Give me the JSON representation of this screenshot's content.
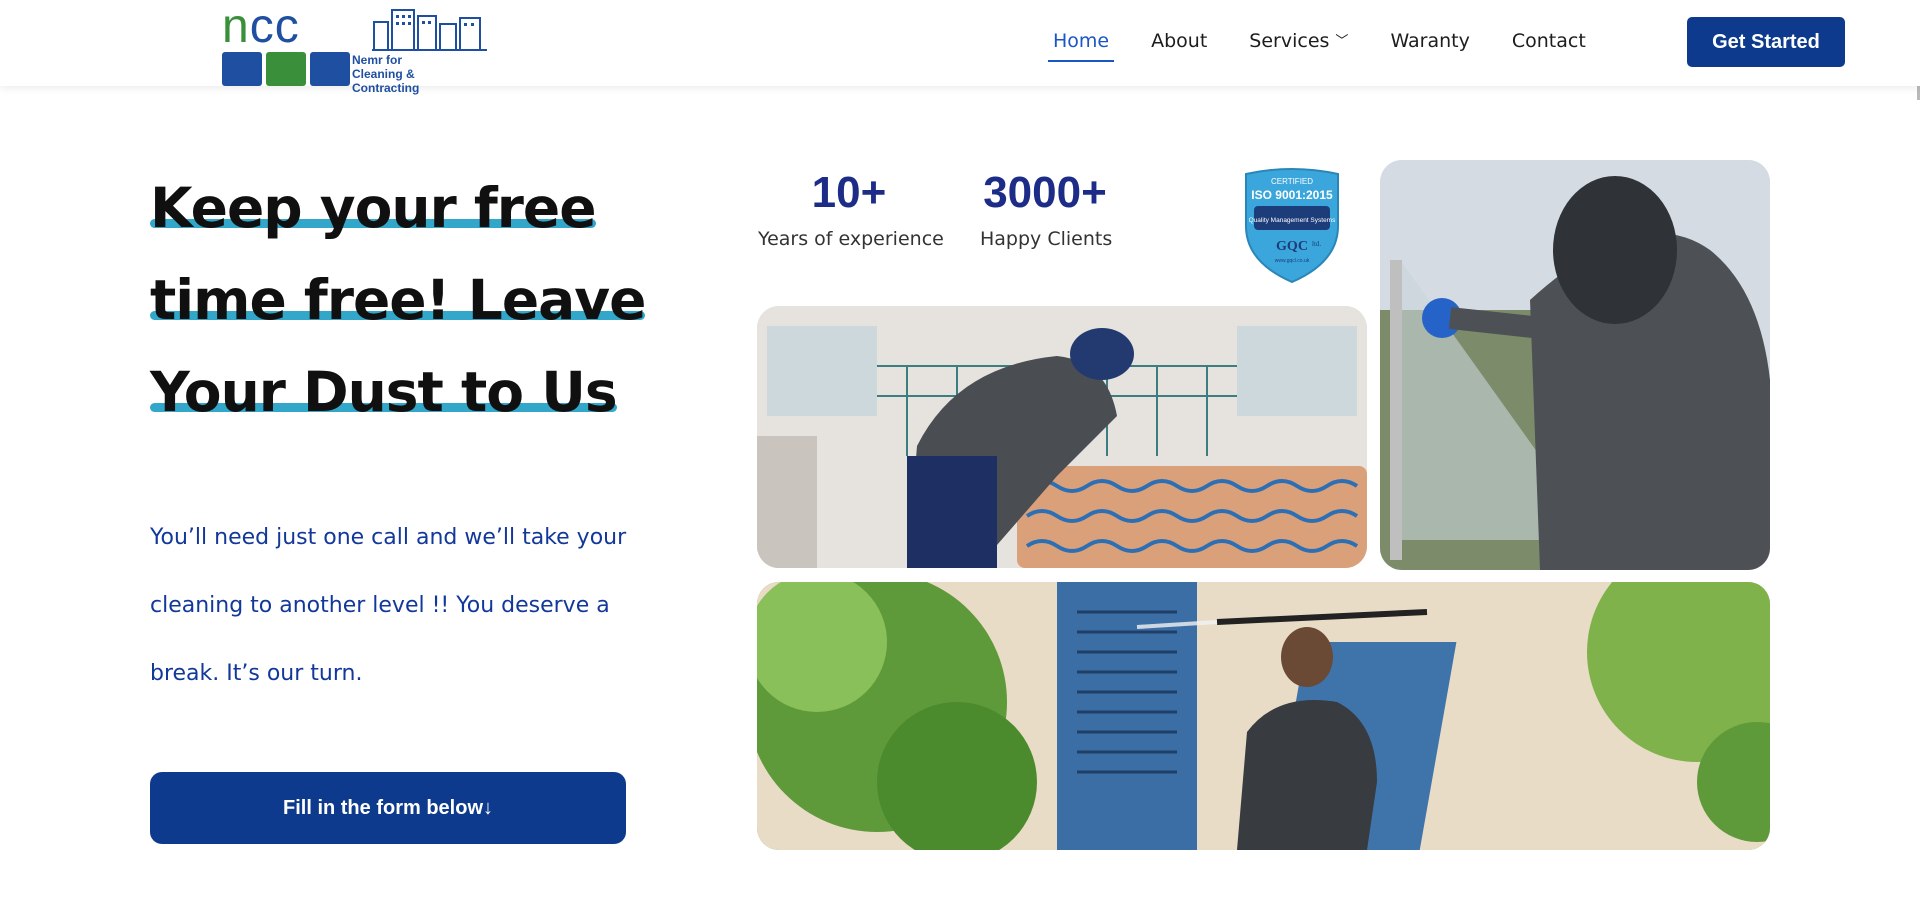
{
  "brand": {
    "logo_letters_n": "n",
    "logo_letters_cc": "cc",
    "tagline": "Nemr for\nCleaning & Contracting",
    "colors": {
      "green": "#3a8f3a",
      "blue": "#1f4fa0"
    }
  },
  "nav": {
    "items": [
      {
        "label": "Home",
        "active": true
      },
      {
        "label": "About"
      },
      {
        "label": "Services",
        "has_dropdown": true
      },
      {
        "label": "Waranty"
      },
      {
        "label": "Contact"
      }
    ],
    "cta_label": "Get Started"
  },
  "hero": {
    "headline_lines": [
      "Keep your free",
      "time free! Leave",
      "Your Dust to Us"
    ],
    "subtext": "You’ll need just one call and we’ll take your cleaning to another level !! You deserve a break. It’s our turn.",
    "cta_label": "Fill in the form below↓"
  },
  "stats": [
    {
      "value": "10+",
      "label": "Years of experience"
    },
    {
      "value": "3000+",
      "label": "Happy Clients"
    }
  ],
  "badge": {
    "top": "CERTIFIED",
    "standard": "ISO 9001:2015",
    "desc": "Quality Management Systems",
    "issuer": "GQC",
    "issuer_suffix": "ltd.",
    "url": "www.gqcl.co.uk"
  },
  "colors": {
    "primary": "#0d3a8c",
    "accent_underline": "#33a7c9",
    "stat_number": "#1d2c86",
    "link_active": "#1a56c4",
    "subtext": "#12389a"
  }
}
